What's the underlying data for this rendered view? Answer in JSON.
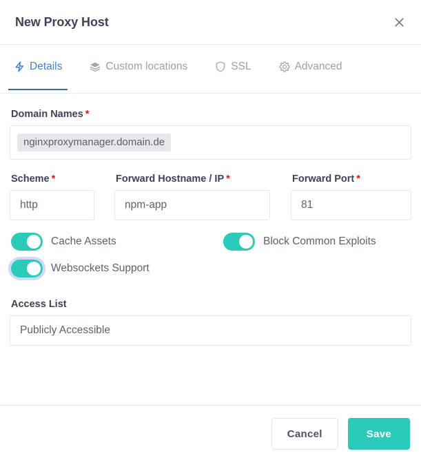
{
  "modal": {
    "title": "New Proxy Host",
    "close_icon": "close-icon"
  },
  "tabs": [
    {
      "label": "Details",
      "icon": "lightning-bolt-icon",
      "active": true
    },
    {
      "label": "Custom locations",
      "icon": "layers-icon",
      "active": false
    },
    {
      "label": "SSL",
      "icon": "shield-icon",
      "active": false
    },
    {
      "label": "Advanced",
      "icon": "gear-icon",
      "active": false
    }
  ],
  "form": {
    "domain_names": {
      "label": "Domain Names",
      "required_marker": "*",
      "tags": [
        "nginxproxymanager.domain.de"
      ],
      "placeholder": ""
    },
    "scheme": {
      "label": "Scheme",
      "required_marker": "*",
      "value": "http",
      "placeholder": "http"
    },
    "forward_hostname": {
      "label": "Forward Hostname / IP",
      "required_marker": "*",
      "value": "npm-app",
      "placeholder": "npm-app"
    },
    "forward_port": {
      "label": "Forward Port",
      "required_marker": "*",
      "value": "81",
      "placeholder": "81"
    },
    "toggles": [
      {
        "label": "Cache Assets",
        "on": true,
        "focused": false
      },
      {
        "label": "Block Common Exploits",
        "on": true,
        "focused": false
      },
      {
        "label": "Websockets Support",
        "on": true,
        "focused": true
      }
    ],
    "access_list": {
      "label": "Access List",
      "value": "Publicly Accessible",
      "placeholder": "Publicly Accessible"
    }
  },
  "footer": {
    "cancel_label": "Cancel",
    "save_label": "Save"
  },
  "colors": {
    "accent_teal": "#2bcbba",
    "active_tab_blue": "#467fcf",
    "required_red": "#cd201f",
    "tag_bg": "#e5e7ea"
  }
}
